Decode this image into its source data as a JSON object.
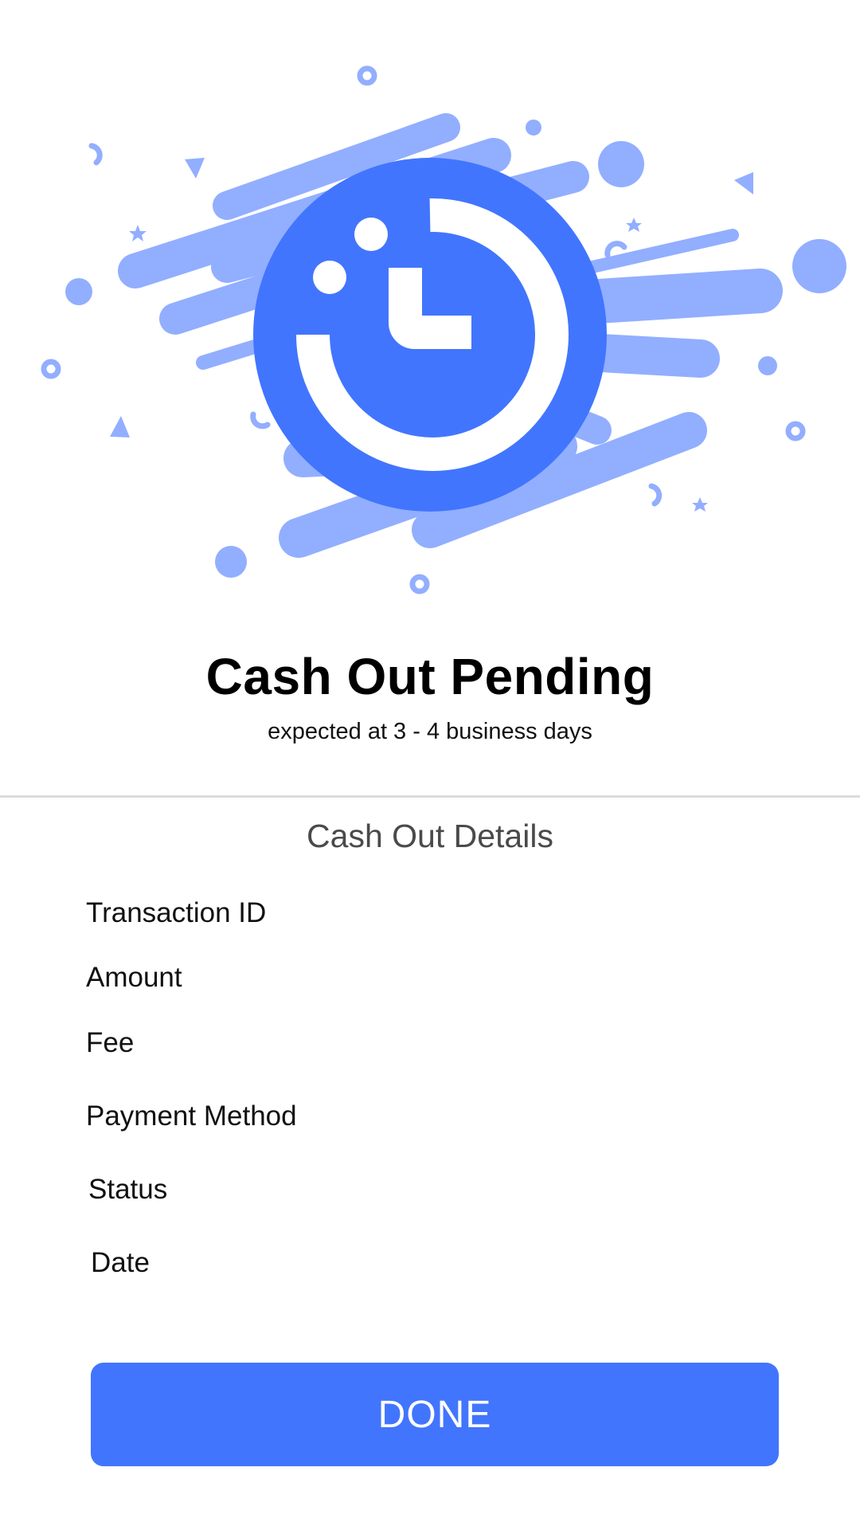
{
  "colors": {
    "accent": "#4275fe",
    "accent_light": "#92aeff",
    "divider": "#dcdcdc"
  },
  "hero": {
    "icon": "clock-pending-icon"
  },
  "header": {
    "title": "Cash Out Pending",
    "subtitle": "expected at 3 - 4 business days"
  },
  "details": {
    "title": "Cash Out Details",
    "rows": [
      {
        "label": "Transaction ID",
        "value": ""
      },
      {
        "label": "Amount",
        "value": ""
      },
      {
        "label": "Fee",
        "value": ""
      },
      {
        "label": "Payment Method",
        "value": ""
      },
      {
        "label": "Status",
        "value": ""
      },
      {
        "label": "Date",
        "value": ""
      }
    ]
  },
  "actions": {
    "done_label": "DONE"
  }
}
